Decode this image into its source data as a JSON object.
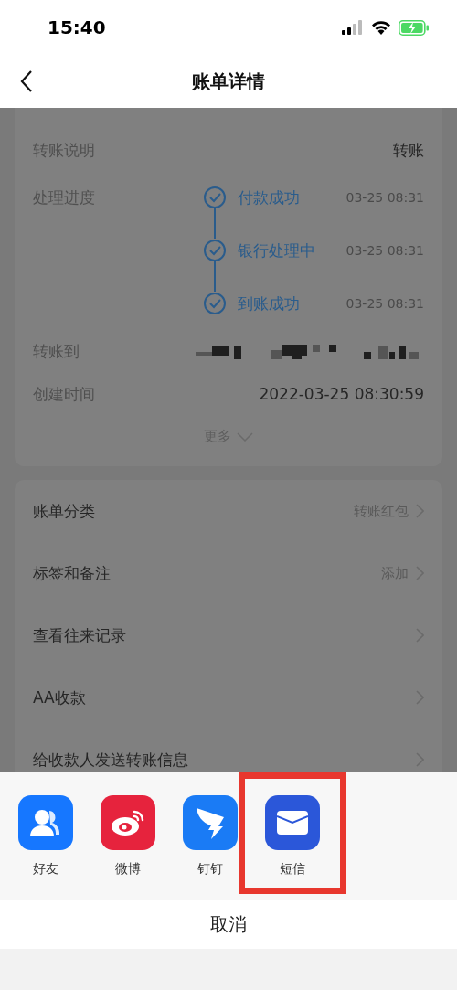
{
  "status_bar": {
    "time": "15:40"
  },
  "nav": {
    "title": "账单详情"
  },
  "details": [
    {
      "kind": "text",
      "label": "转账说明",
      "value": "转账"
    },
    {
      "kind": "progress",
      "label": "处理进度",
      "steps": [
        {
          "label": "付款成功",
          "time": "03-25 08:31",
          "done": true
        },
        {
          "label": "银行处理中",
          "time": "03-25 08:31",
          "done": true
        },
        {
          "label": "到账成功",
          "time": "03-25 08:31",
          "done": true
        }
      ]
    },
    {
      "kind": "redacted",
      "label": "转账到"
    },
    {
      "kind": "text",
      "label": "创建时间",
      "value": "2022-03-25 08:30:59"
    }
  ],
  "more": "更多",
  "menu": [
    {
      "label": "账单分类",
      "value": "转账红包"
    },
    {
      "label": "标签和备注",
      "value": "添加"
    },
    {
      "label": "查看往来记录"
    },
    {
      "label": "AA收款"
    },
    {
      "label": "给收款人发送转账信息"
    }
  ],
  "share": [
    {
      "kind": "friends",
      "label": "好友",
      "color": "#1677ff",
      "highlighted": false
    },
    {
      "kind": "weibo",
      "label": "微博",
      "color": "#e6233d",
      "highlighted": false
    },
    {
      "kind": "dingtalk",
      "label": "钉钉",
      "color": "#1a7bf5",
      "highlighted": false
    },
    {
      "kind": "sms",
      "label": "短信",
      "color": "#2b57d9",
      "highlighted": true
    }
  ],
  "cancel": "取消"
}
